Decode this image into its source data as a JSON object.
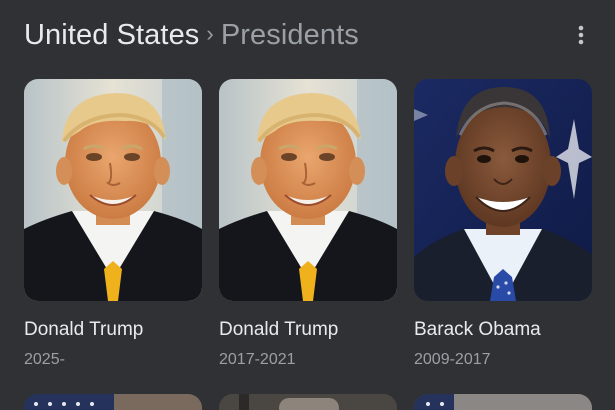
{
  "breadcrumb": {
    "root": "United States",
    "separator": "›",
    "current": "Presidents"
  },
  "menu": {
    "icon": "more-vert-icon"
  },
  "cards": [
    {
      "name": "Donald Trump",
      "term": "2025-"
    },
    {
      "name": "Donald Trump",
      "term": "2017-2021"
    },
    {
      "name": "Barack Obama",
      "term": "2009-2017"
    }
  ],
  "colors": {
    "background": "#303134",
    "primary_text": "#e8eaed",
    "secondary_text": "#9aa0a6"
  }
}
